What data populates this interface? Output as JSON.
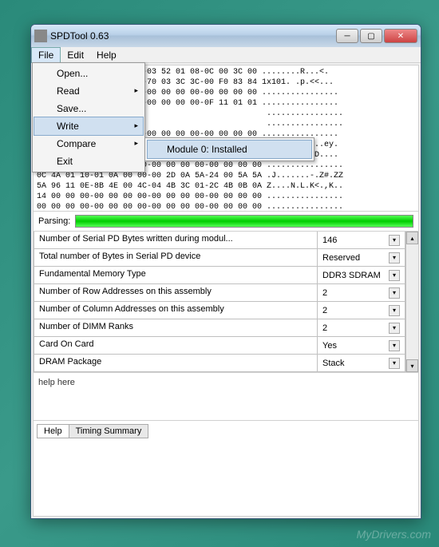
{
  "window": {
    "title": "SPDTool 0.63"
  },
  "menubar": {
    "items": [
      "File",
      "Edit",
      "Help"
    ]
  },
  "file_menu": {
    "open": "Open...",
    "read": "Read",
    "save": "Save...",
    "write": "Write",
    "compare": "Compare",
    "exit": "Exit"
  },
  "write_submenu": {
    "item0": "Module 0: Installed"
  },
  "hex": {
    "l0": "                  0 09-03 52 01 08-0C 00 3C 00 ........R...<.",
    "l1": "                  0 3D-70 03 3C 3C-00 F0 83 84 1x101. .p.<<...",
    "l2": "                  0 00-00 00 00 00-00 00 00 00 ................",
    "l3": "                  0 00-00 00 00 00-0F 11 01 01 ................",
    "l4": "                                                ................",
    "l5": "                                                ................",
    "l6": "                  0 00-00 00 00 00-00 00 00 00 ................",
    "l7": "                  A 00-10 60 02 01-00 65 79 9E ......z......ey.",
    "l8": "                  A 35-2E 39 4B 44-FF FF FF FF 78.AAGD5.9KD....",
    "l9": "00 00 00 00-00 00 00 00-00 00 00 00-00 00 00 00 ................",
    "l10": "0C 4A 01 10-01 0A 00 00-00 2D 0A 5A-24 00 5A 5A .J.......-.Z#.ZZ",
    "l11": "5A 96 11 0E-8B 4E 00 4C-04 4B 3C 01-2C 4B 0B 0A Z....N.L.K<.,K..",
    "l12": "14 00 00 00-00 00 00 00-00 00 00 00-00 00 00 00 ................",
    "l13": "00 00 00 00-00 00 00 00-00 00 00 00-00 00 00 00 ................"
  },
  "parsing": {
    "label": "Parsing:"
  },
  "grid": {
    "rows": [
      {
        "label": "Number of Serial PD Bytes written during modul...",
        "value": "146"
      },
      {
        "label": "Total number of Bytes in Serial PD device",
        "value": "Reserved"
      },
      {
        "label": "Fundamental Memory Type",
        "value": "DDR3 SDRAM"
      },
      {
        "label": "Number of Row Addresses on this assembly",
        "value": "2"
      },
      {
        "label": "Number of Column Addresses on this assembly",
        "value": "2"
      },
      {
        "label": "Number of DIMM Ranks",
        "value": "2"
      },
      {
        "label": "Card On Card",
        "value": "Yes"
      },
      {
        "label": "DRAM Package",
        "value": "Stack"
      }
    ]
  },
  "help": {
    "text": "help here"
  },
  "tabs": {
    "help": "Help",
    "timing": "Timing Summary"
  },
  "watermark": "MyDrivers.com"
}
